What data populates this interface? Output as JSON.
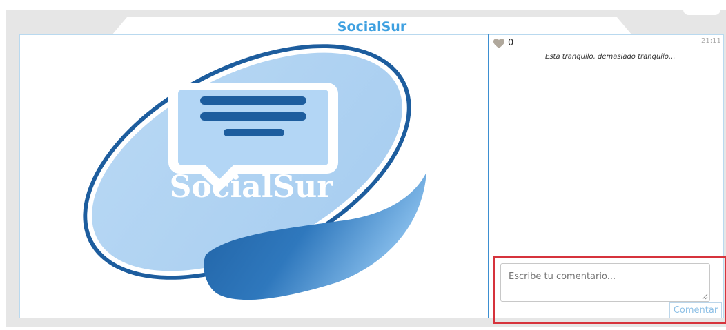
{
  "app": {
    "title": "SocialSur"
  },
  "post": {
    "image_logo_text": "SocialSur",
    "likes": "0",
    "time": "21:11",
    "text": "Esta tranquilo, demasiado tranquilo..."
  },
  "comment": {
    "placeholder": "Escribe tu comentario...",
    "button_label": "Comentar"
  },
  "colors": {
    "title": "#3ea0e0",
    "highlight": "#d6333c",
    "logo_dark": "#1d5d9e",
    "logo_light": "#b2d4f2"
  },
  "icons": [
    "heart-icon",
    "resize-grip-icon"
  ]
}
